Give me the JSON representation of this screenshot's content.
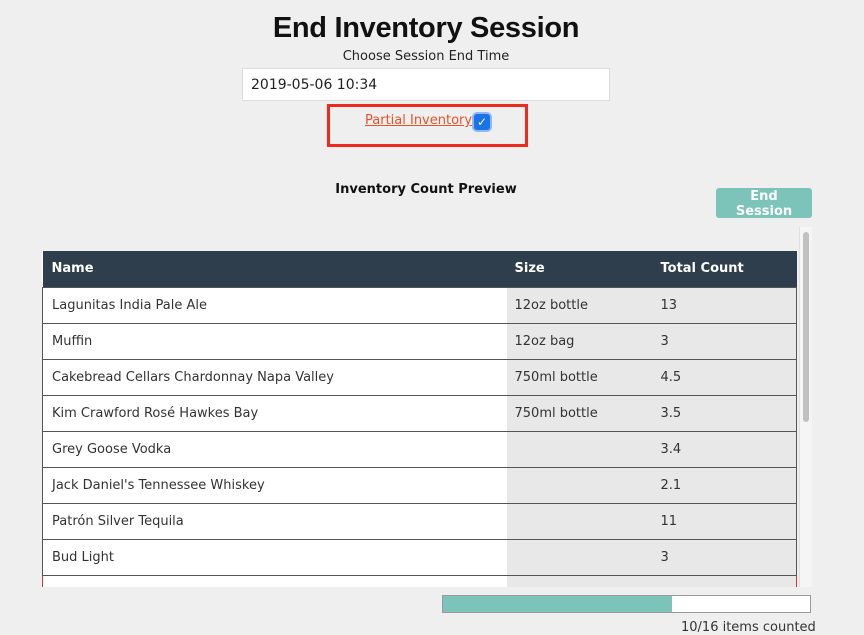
{
  "page": {
    "title": "End Inventory Session",
    "subtitle": "Choose Session End Time"
  },
  "end_time": {
    "value": "2019-05-06 10:34"
  },
  "partial": {
    "label": "Partial Inventory?",
    "checked": true,
    "check_glyph": "✓"
  },
  "preview": {
    "title": "Inventory Count Preview"
  },
  "end_session_label": "End Session",
  "table": {
    "headers": [
      "Name",
      "Size",
      "Total Count"
    ],
    "rows": [
      {
        "name": "Lagunitas India Pale Ale",
        "size": "12oz bottle",
        "total": "13"
      },
      {
        "name": "Muffin",
        "size": "12oz bag",
        "total": "3"
      },
      {
        "name": "Cakebread Cellars Chardonnay Napa Valley",
        "size": "750ml bottle",
        "total": "4.5"
      },
      {
        "name": "Kim Crawford Rosé Hawkes Bay",
        "size": "750ml bottle",
        "total": "3.5"
      },
      {
        "name": "Grey Goose Vodka",
        "size": "",
        "total": "3.4"
      },
      {
        "name": "Jack Daniel's Tennessee Whiskey",
        "size": "",
        "total": "2.1"
      },
      {
        "name": "Patrón Silver Tequila",
        "size": "",
        "total": "11"
      },
      {
        "name": "Bud Light",
        "size": "",
        "total": "3"
      },
      {
        "name": "",
        "size": "",
        "total": ""
      }
    ]
  },
  "progress": {
    "counted": 10,
    "total": 16,
    "text": "10/16 items counted"
  },
  "colors": {
    "accent": "#7cc4b9",
    "header": "#2e3e4c",
    "highlight": "#ee2a1f",
    "link": "#e5532d"
  }
}
